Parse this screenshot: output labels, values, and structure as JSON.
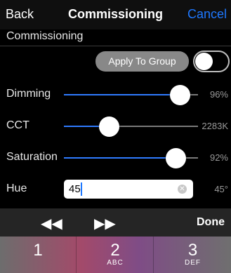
{
  "navbar": {
    "back_label": "Back",
    "title": "Commissioning",
    "cancel_label": "Cancel"
  },
  "section": {
    "title": "Commissioning"
  },
  "group": {
    "apply_label": "Apply To Group",
    "toggle_on": false
  },
  "sliders": [
    {
      "label": "Dimming",
      "value_text": "96%",
      "level": 0.96
    },
    {
      "label": "CCT",
      "value_text": "2283K",
      "level": 0.29
    },
    {
      "label": "Saturation",
      "value_text": "92%",
      "level": 0.92
    }
  ],
  "hue": {
    "label": "Hue",
    "input_value": "45",
    "value_text": "45°"
  },
  "accessory": {
    "prev_icon": "rewind-icon",
    "next_icon": "fast-forward-icon",
    "done_label": "Done"
  },
  "keyboard": {
    "keys": [
      {
        "digit": "1",
        "letters": ""
      },
      {
        "digit": "2",
        "letters": "ABC"
      },
      {
        "digit": "3",
        "letters": "DEF"
      }
    ]
  },
  "colors": {
    "accent": "#2f7bff",
    "cancel": "#1e78ff"
  }
}
